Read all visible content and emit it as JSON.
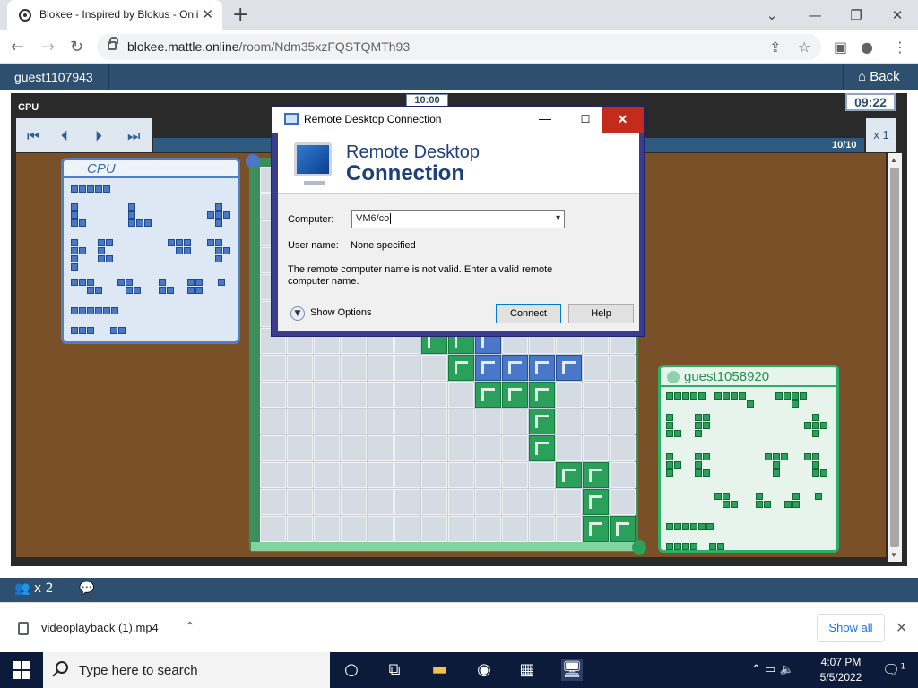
{
  "browser": {
    "tab_title": "Blokee - Inspired by Blokus - Online",
    "url_host": "blokee.mattle.online",
    "url_path": "/room/Ndm35xzFQSTQMTh93"
  },
  "game": {
    "username": "guest1107943",
    "back_label": "Back",
    "cpu_label": "CPU",
    "timer_center": "10:00",
    "timer_right": "09:22",
    "progress_label": "10/10",
    "progress": 1.0,
    "speed_label": "x 1",
    "players_count": "x 2",
    "cpu_panel_title": "CPU",
    "guest_panel_title": "guest1058920"
  },
  "rdp": {
    "window_title": "Remote Desktop Connection",
    "banner_line1": "Remote Desktop",
    "banner_line2": "Connection",
    "computer_label": "Computer:",
    "computer_value": "VM6/co",
    "username_label": "User name:",
    "username_value": "None specified",
    "error_text": "The remote computer name is not valid. Enter a valid remote computer name.",
    "show_options": "Show Options",
    "connect_button": "Connect",
    "help_button": "Help"
  },
  "downloads": {
    "file_name": "videoplayback (1).mp4",
    "show_all": "Show all"
  },
  "taskbar": {
    "search_placeholder": "Type here to search",
    "time": "4:07 PM",
    "date": "5/5/2022",
    "notification_count": "1"
  },
  "colors": {
    "header_blue": "#2e4f6e",
    "board_wood": "#7a5028",
    "cpu_blue": "#4a78c8",
    "guest_green": "#2aa05a",
    "rdp_close_red": "#c42b1c"
  }
}
